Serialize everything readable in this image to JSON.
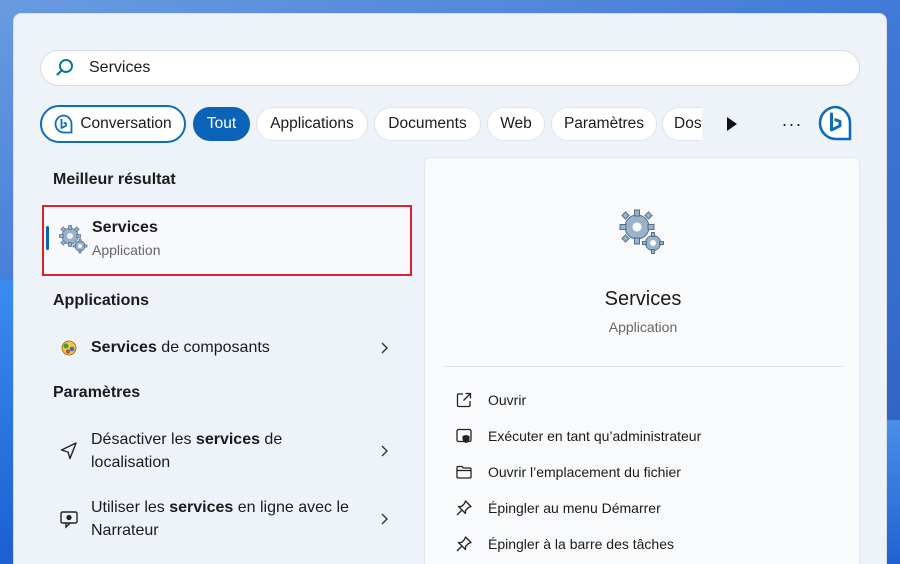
{
  "search": {
    "value": "Services"
  },
  "filters": {
    "conversation": "Conversation",
    "tout": "Tout",
    "applications": "Applications",
    "documents": "Documents",
    "web": "Web",
    "parametres": "Paramètres",
    "dos": "Dos"
  },
  "left": {
    "best_result_heading": "Meilleur résultat",
    "best_result": {
      "title": "Services",
      "subtitle": "Application"
    },
    "applications_heading": "Applications",
    "app_item": {
      "bold": "Services",
      "rest": " de composants"
    },
    "settings_heading": "Paramètres",
    "setting1": {
      "pre": "Désactiver les ",
      "bold": "services",
      "post": " de",
      "line2": "localisation"
    },
    "setting2": {
      "pre": "Utiliser les ",
      "bold": "services",
      "post": " en ligne avec le",
      "line2": "Narrateur"
    }
  },
  "right": {
    "title": "Services",
    "subtitle": "Application",
    "actions": [
      "Ouvrir",
      "Exécuter en tant qu’administrateur",
      "Ouvrir l’emplacement du fichier",
      "Épingler au menu Démarrer",
      "Épingler à la barre des tâches"
    ]
  },
  "colors": {
    "accent": "#0b63b8",
    "highlight": "#e0202e"
  }
}
